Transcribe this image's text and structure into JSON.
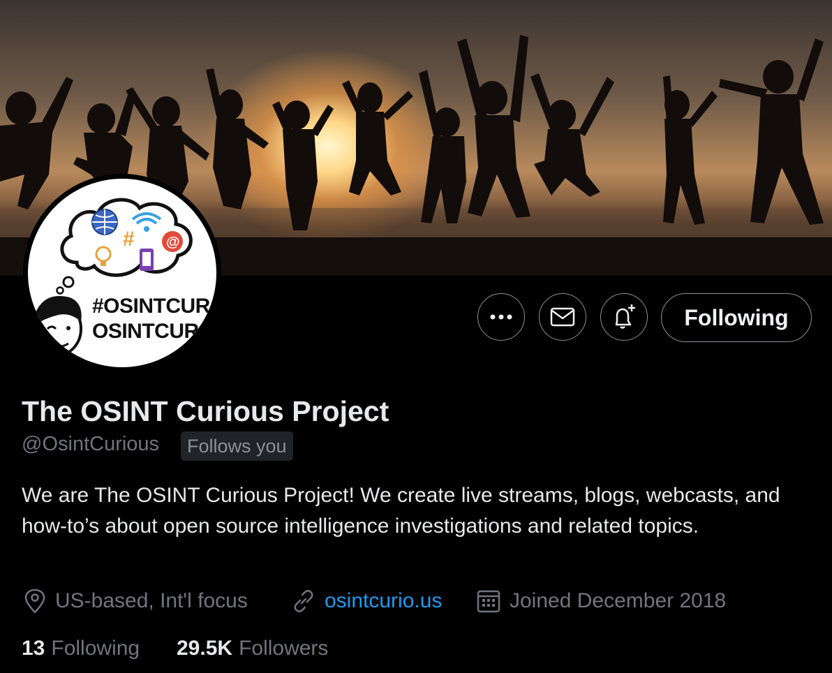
{
  "banner": {
    "description_icon": "banner-photo"
  },
  "avatar": {
    "line1": "#OSINTCUR",
    "line1_tail": "",
    "line2": "OSINTCUR"
  },
  "actions": {
    "more_icon": "more-icon",
    "message_icon": "mail-icon",
    "notify_icon": "bell-plus-icon",
    "follow_label": "Following"
  },
  "profile": {
    "name": "The OSINT Curious Project",
    "handle": "@OsintCurious",
    "follows_you": "Follows you",
    "bio": "We are The OSINT Curious Project! We create live streams, blogs, webcasts, and how-to’s about open source intelligence investigations and related topics.",
    "location": "US-based, Int'l focus",
    "website": "osintcurio.us",
    "joined": "Joined December 2018"
  },
  "stats": {
    "following_count": "13",
    "following_label": "Following",
    "followers_count": "29.5K",
    "followers_label": "Followers"
  },
  "colors": {
    "background": "#000000",
    "link": "#1d9bf0",
    "muted": "#71767b",
    "text": "#e7e9ea"
  }
}
